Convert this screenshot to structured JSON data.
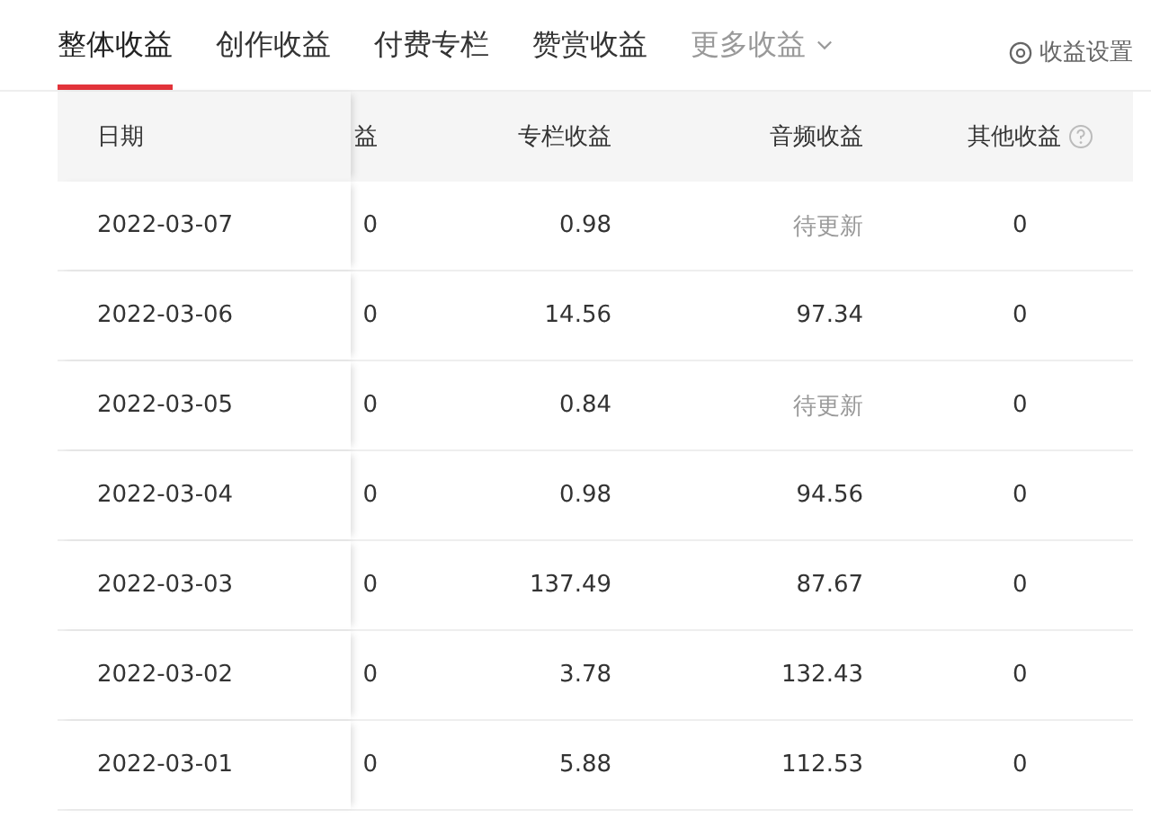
{
  "tabs": [
    {
      "label": "整体收益",
      "selected": true,
      "kind": "tab"
    },
    {
      "label": "创作收益",
      "selected": false,
      "kind": "tab"
    },
    {
      "label": "付费专栏",
      "selected": false,
      "kind": "tab"
    },
    {
      "label": "赞赏收益",
      "selected": false,
      "kind": "tab"
    },
    {
      "label": "更多收益",
      "selected": false,
      "kind": "dropdown"
    }
  ],
  "settings_link": "收益设置",
  "table": {
    "columns": [
      "日期",
      "益",
      "专栏收益",
      "音频收益",
      "其他收益"
    ],
    "rows": [
      {
        "date": "2022-03-07",
        "column_2": "0",
        "column": "0.98",
        "audio": {
          "text": "待更新",
          "pending": true
        },
        "other": "0"
      },
      {
        "date": "2022-03-06",
        "column_2": "0",
        "column": "14.56",
        "audio": {
          "text": "97.34",
          "pending": false
        },
        "other": "0"
      },
      {
        "date": "2022-03-05",
        "column_2": "0",
        "column": "0.84",
        "audio": {
          "text": "待更新",
          "pending": true
        },
        "other": "0"
      },
      {
        "date": "2022-03-04",
        "column_2": "0",
        "column": "0.98",
        "audio": {
          "text": "94.56",
          "pending": false
        },
        "other": "0"
      },
      {
        "date": "2022-03-03",
        "column_2": "0",
        "column": "137.49",
        "audio": {
          "text": "87.67",
          "pending": false
        },
        "other": "0"
      },
      {
        "date": "2022-03-02",
        "column_2": "0",
        "column": "3.78",
        "audio": {
          "text": "132.43",
          "pending": false
        },
        "other": "0"
      },
      {
        "date": "2022-03-01",
        "column_2": "0",
        "column": "5.88",
        "audio": {
          "text": "112.53",
          "pending": false
        },
        "other": "0"
      }
    ]
  }
}
